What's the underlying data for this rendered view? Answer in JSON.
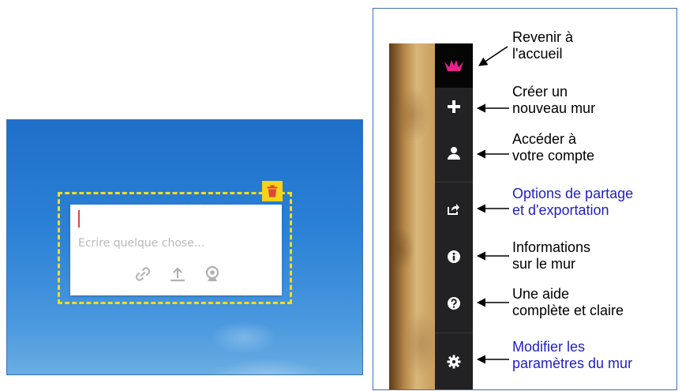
{
  "note": {
    "placeholder": "Écrire quelque chose...",
    "tools": [
      "link-icon",
      "upload-icon",
      "webcam-icon"
    ],
    "delete_icon": "trash-icon"
  },
  "colors": {
    "frame": "#f2dc1d",
    "trash_bg": "#f7d21b",
    "trash_icon": "#e0443a",
    "logo": "#e8208c",
    "sidebar": "#222224",
    "annotation_blue": "#1f1fc0"
  },
  "sidebar": {
    "items": [
      {
        "icon": "logo-icon",
        "line1": "Revenir à",
        "line2": "l'accueil",
        "style": "black"
      },
      {
        "icon": "plus-icon",
        "line1": "Créer un",
        "line2": "nouveau mur",
        "style": "black"
      },
      {
        "icon": "user-icon",
        "line1": "Accéder à",
        "line2": "votre compte",
        "style": "black"
      },
      {
        "icon": "share-icon",
        "line1": "Options de partage",
        "line2": "et d'exportation",
        "style": "blue"
      },
      {
        "icon": "info-icon",
        "line1": "Informations",
        "line2": "sur le mur",
        "style": "black"
      },
      {
        "icon": "help-icon",
        "line1": "Une aide",
        "line2": "complète et claire",
        "style": "black"
      },
      {
        "icon": "gear-icon",
        "line1": "Modifier les",
        "line2": "paramètres du mur",
        "style": "blue"
      }
    ]
  }
}
